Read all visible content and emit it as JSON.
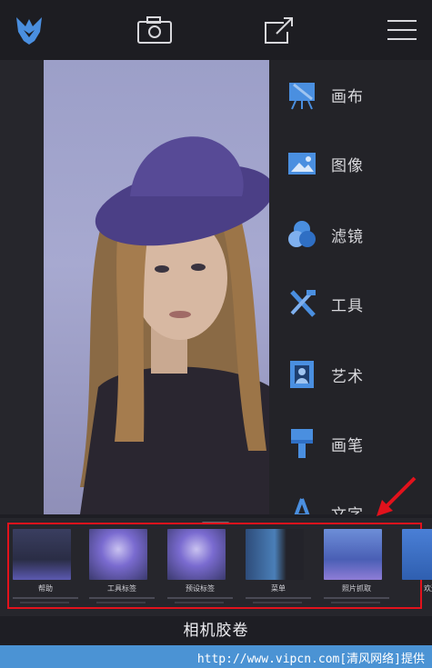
{
  "toolbar": {
    "logo_icon": "fox-logo-icon",
    "camera_icon": "camera-icon",
    "share_icon": "share-icon",
    "menu_icon": "hamburger-menu-icon"
  },
  "tools": [
    {
      "label": "画布",
      "icon": "canvas-easel-icon"
    },
    {
      "label": "图像",
      "icon": "image-icon"
    },
    {
      "label": "滤镜",
      "icon": "filter-circles-icon"
    },
    {
      "label": "工具",
      "icon": "tools-icon"
    },
    {
      "label": "艺术",
      "icon": "art-frame-icon"
    },
    {
      "label": "画笔",
      "icon": "brush-icon"
    },
    {
      "label": "文字",
      "icon": "text-icon"
    }
  ],
  "filmstrip": {
    "items": [
      {
        "caption": "帮助"
      },
      {
        "caption": "工具标签"
      },
      {
        "caption": "预设标签"
      },
      {
        "caption": "菜单"
      },
      {
        "caption": "照片抓取"
      },
      {
        "caption": "欢迎使"
      }
    ]
  },
  "camera_roll": "相机胶卷",
  "footer": "http://www.vipcn.com[清风网络]提供",
  "colors": {
    "accent": "#4b93d4",
    "highlight": "#e2121c",
    "icon_blue": "#4a8fe0"
  }
}
